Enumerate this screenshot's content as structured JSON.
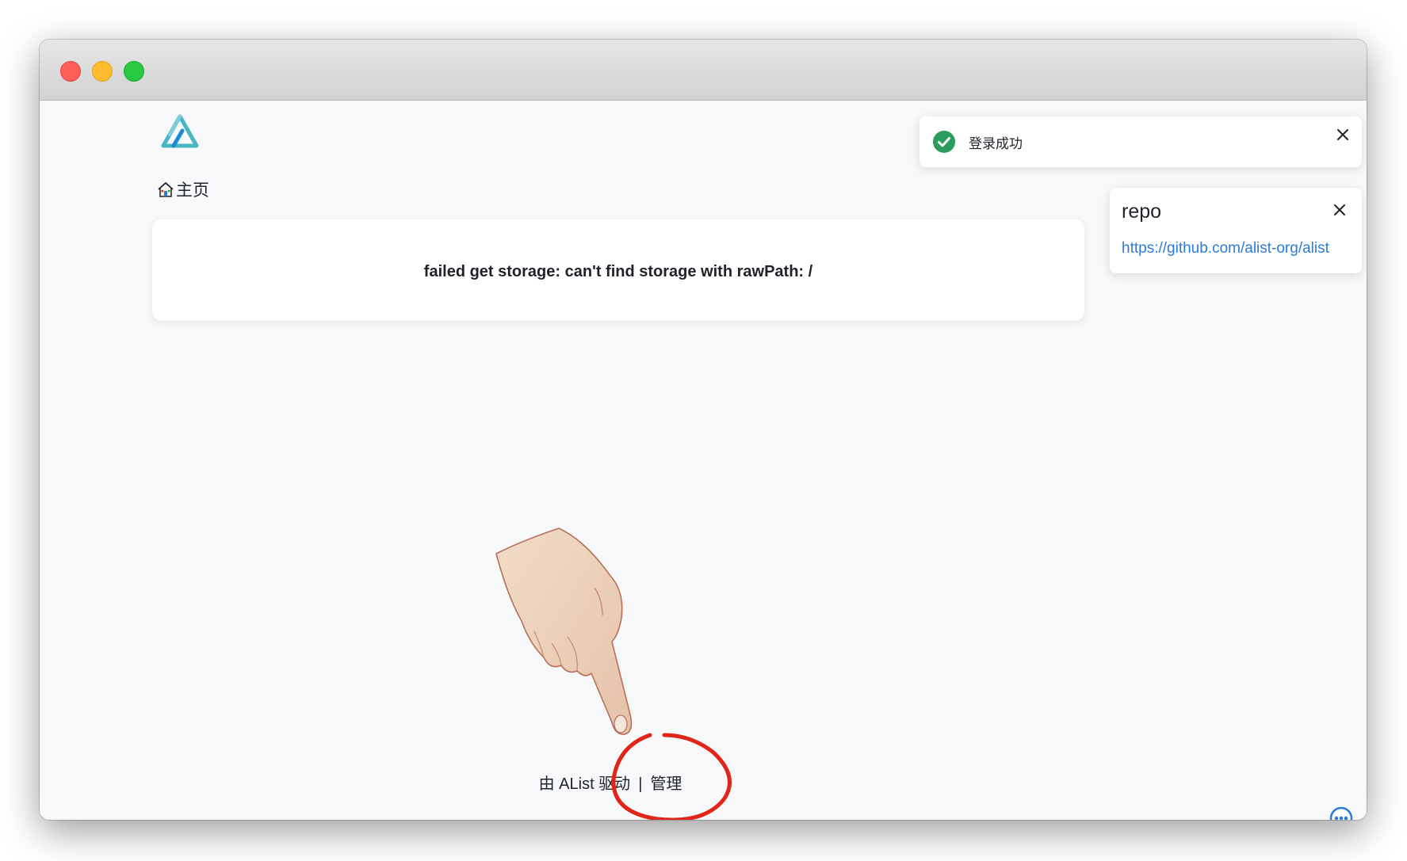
{
  "breadcrumb": {
    "home_label": "主页"
  },
  "error": {
    "message": "failed get storage: can't find storage with rawPath: /"
  },
  "toast": {
    "message": "登录成功",
    "status_color": "#2a9d5c"
  },
  "repo_notice": {
    "title": "repo",
    "link": "https://github.com/alist-org/alist"
  },
  "footer": {
    "powered_by": "由 AList 驱动",
    "separator": "|",
    "manage_label": "管理"
  },
  "colors": {
    "accent": "#2b7bd8",
    "annotation": "#e0261a",
    "logo": "#4ab5c3"
  },
  "icons": {
    "home": "home-icon",
    "success": "check-circle-icon",
    "close": "close-icon",
    "more": "more-horizontal-circle-icon"
  }
}
